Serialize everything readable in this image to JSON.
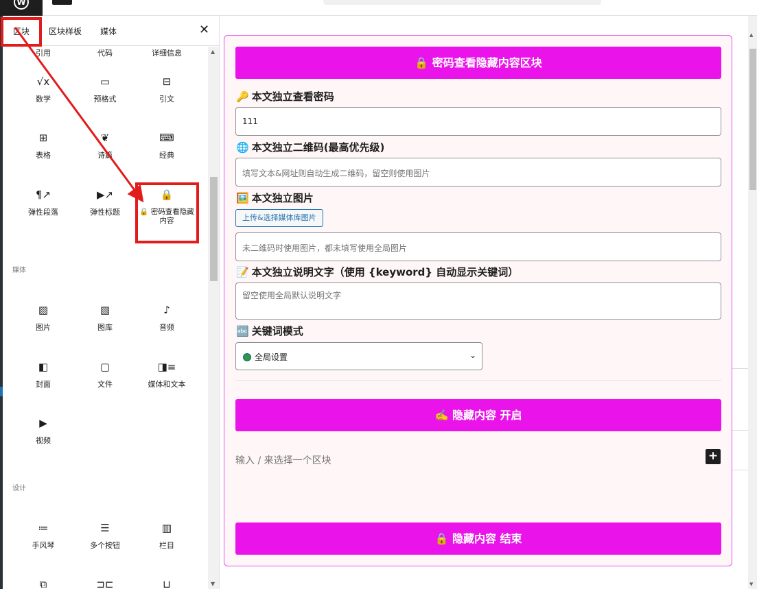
{
  "top": {
    "logo": "W"
  },
  "panel": {
    "tabs": [
      {
        "label": "区块"
      },
      {
        "label": "区块样板"
      },
      {
        "label": "媒体"
      }
    ],
    "close": "✕",
    "partial_row": [
      "引用",
      "代码",
      "详细信息"
    ],
    "blocks": [
      {
        "label": "数学",
        "icon": "√x"
      },
      {
        "label": "预格式",
        "icon": "▭"
      },
      {
        "label": "引文",
        "icon": "⊟"
      },
      {
        "label": "表格",
        "icon": "⊞"
      },
      {
        "label": "诗篇",
        "icon": "❦"
      },
      {
        "label": "经典",
        "icon": "⌨"
      },
      {
        "label": "弹性段落",
        "icon": "¶↗"
      },
      {
        "label": "弹性标题",
        "icon": "▶↗"
      },
      {
        "label": "🔒 密码查看隐藏内容",
        "icon": "🔒"
      }
    ],
    "cat_media": "媒体",
    "media_blocks": [
      {
        "label": "图片",
        "icon": "▨"
      },
      {
        "label": "图库",
        "icon": "▧"
      },
      {
        "label": "音频",
        "icon": "♪"
      },
      {
        "label": "封面",
        "icon": "◧"
      },
      {
        "label": "文件",
        "icon": "▢"
      },
      {
        "label": "媒体和文本",
        "icon": "◨≡"
      },
      {
        "label": "视频",
        "icon": "▶"
      }
    ],
    "cat_design": "设计",
    "design_blocks": [
      {
        "label": "手风琴",
        "icon": "≔"
      },
      {
        "label": "多个按钮",
        "icon": "☰"
      },
      {
        "label": "栏目",
        "icon": "▥"
      }
    ],
    "bottom_icons": [
      "⧉",
      "⊐⊏",
      "⊔"
    ]
  },
  "editor": {
    "header_btn": "🔒 密码查看隐藏内容区块",
    "pwd_label": {
      "emoji": "🔑",
      "text": "本文独立查看密码"
    },
    "pwd_value": "111",
    "qr_label": {
      "emoji": "🌐",
      "text": "本文独立二维码(最高优先级)"
    },
    "qr_placeholder": "填写文本&网址则自动生成二维码，留空则使用图片",
    "img_label": {
      "emoji": "🖼️",
      "text": "本文独立图片"
    },
    "upload_btn": "上传&选择媒体库图片",
    "img_placeholder": "未二维码时使用图片，都未填写使用全局图片",
    "desc_label": {
      "emoji": "📝",
      "text": "本文独立说明文字（使用 {keyword} 自动显示关键词）"
    },
    "desc_placeholder": "留空使用全局默认说明文字",
    "kw_label": {
      "emoji": "🔤",
      "text": "关键词模式"
    },
    "kw_select": "全局设置",
    "open_btn": "✍️ 隐藏内容 开启",
    "block_placeholder": "输入 / 来选择一个区块",
    "plus": "+",
    "end_btn": "🔒 隐藏内容 结束"
  }
}
